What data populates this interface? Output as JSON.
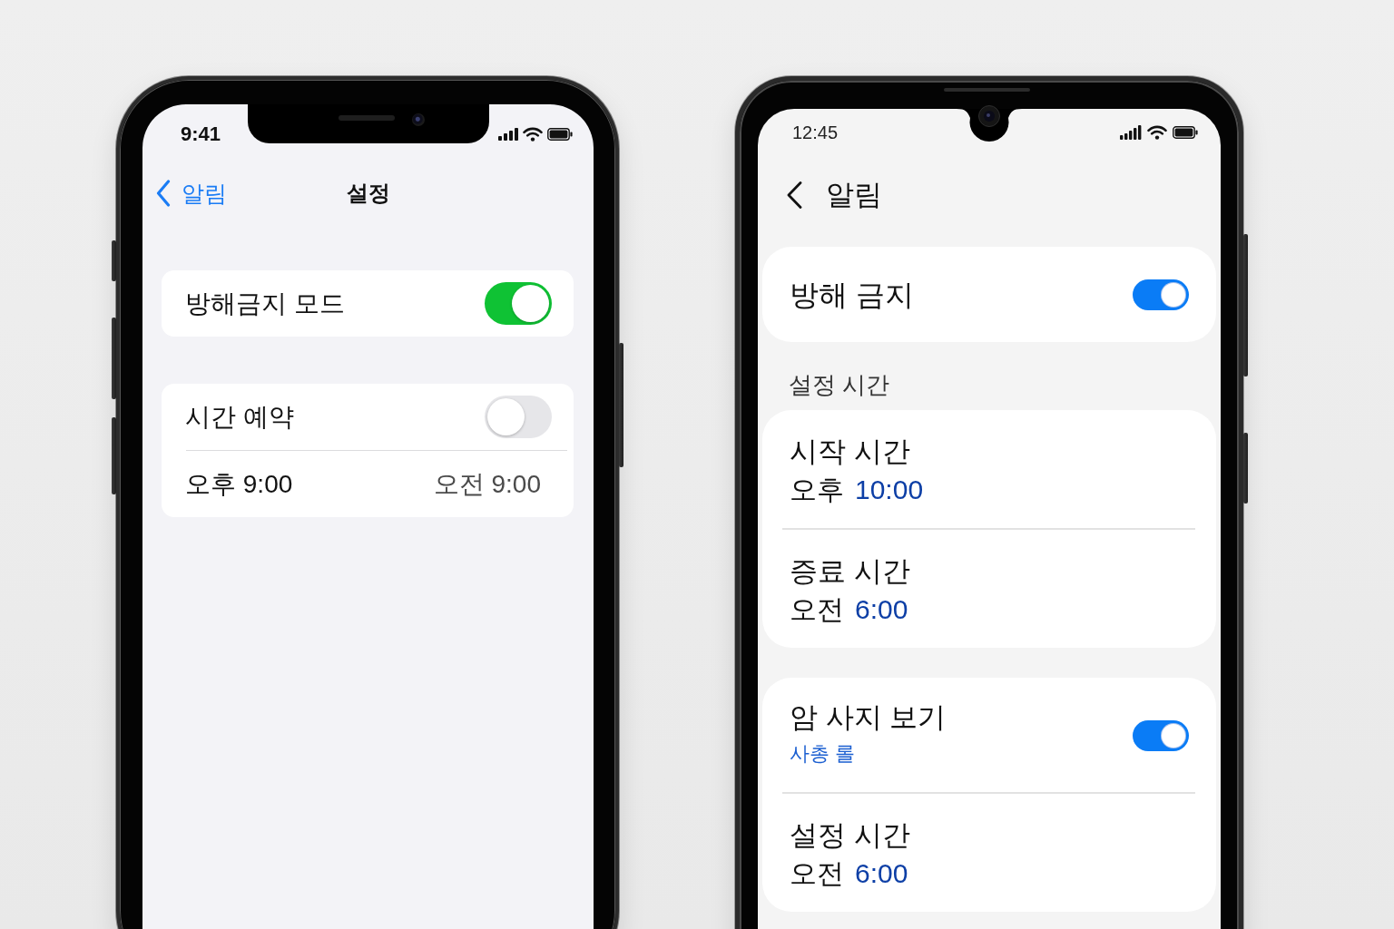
{
  "phones": [
    {
      "kind": "iphone",
      "status_bar": {
        "time": "9:41"
      },
      "nav": {
        "back_label": "알림",
        "title": "설정"
      },
      "groups": [
        {
          "rows": [
            {
              "kind": "toggle",
              "label": "방해금지 모드",
              "on": true
            }
          ]
        },
        {
          "rows": [
            {
              "kind": "toggle",
              "label": "시간 예약",
              "on": false
            },
            {
              "kind": "range",
              "start": "오후 9:00",
              "end": "오전 9:00"
            }
          ]
        }
      ]
    },
    {
      "kind": "android",
      "status_bar": {
        "time": "12:45"
      },
      "nav": {
        "title": "알림"
      },
      "groups": [
        {
          "rows": [
            {
              "kind": "toggle",
              "label": "방해 금지",
              "on": true
            }
          ]
        },
        {
          "header": "설정 시간",
          "rows": [
            {
              "kind": "time",
              "label": "시작 시간",
              "period": "오후",
              "time": "10:00"
            },
            {
              "kind": "time",
              "label": "증료 시간",
              "period": "오전",
              "time": "6:00"
            }
          ]
        },
        {
          "rows": [
            {
              "kind": "toggle",
              "label": "암 사지 보기",
              "sublabel": "사총 롤",
              "on": true
            },
            {
              "kind": "time",
              "label": "설정 시간",
              "period": "오전",
              "time": "6:00"
            }
          ]
        }
      ]
    }
  ]
}
